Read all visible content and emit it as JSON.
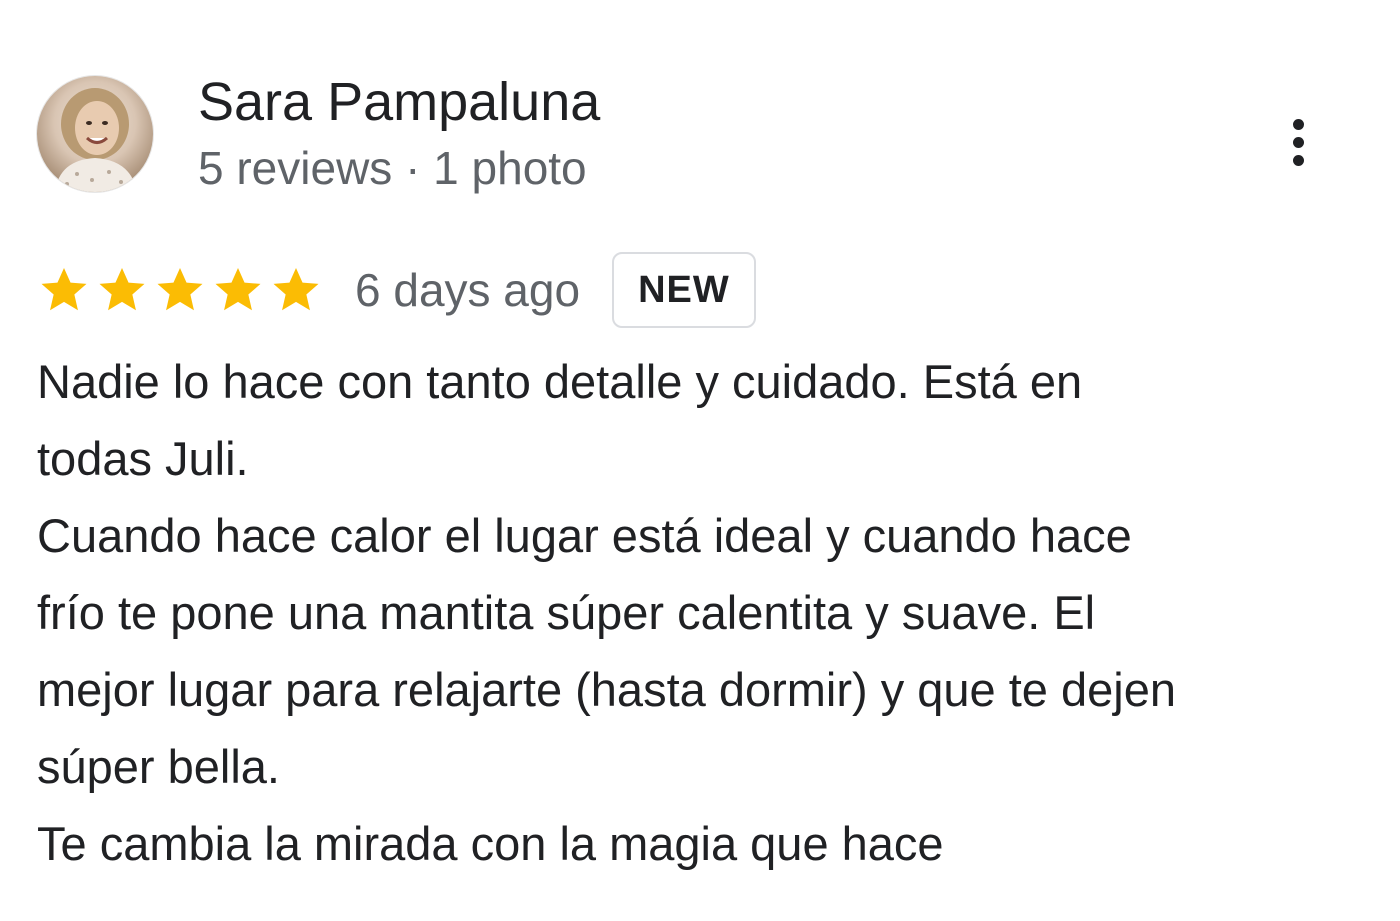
{
  "reviewer": {
    "name": "Sara Pampaluna",
    "meta": "5 reviews · 1 photo"
  },
  "review": {
    "rating": 5,
    "rating_max": 5,
    "star_color": "#FBBC04",
    "date": "6 days ago",
    "badge": "NEW",
    "lines": [
      "Nadie lo hace con tanto detalle y cuidado. Está en",
      "todas Juli.",
      "Cuando hace calor el lugar está ideal y cuando hace",
      "frío te pone una mantita súper calentita y suave. El",
      "mejor lugar para relajarte (hasta dormir) y que te dejen",
      "súper bella.",
      "Te cambia la mirada con la magia que hace"
    ]
  },
  "icons": {
    "more": "more-vert-icon",
    "star": "star-icon",
    "avatar": "user-photo-avatar"
  }
}
